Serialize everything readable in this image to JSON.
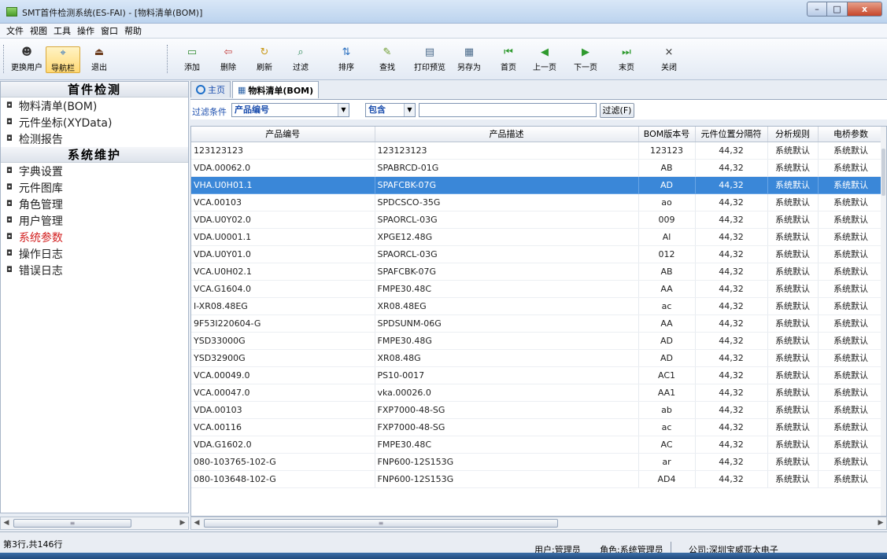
{
  "window": {
    "title": "SMT首件检测系统(ES-FAI) - [物料清单(BOM)]",
    "buttons": {
      "minimize": "–",
      "maximize": "□",
      "close": "x"
    }
  },
  "menu": [
    "文件",
    "视图",
    "工具",
    "操作",
    "窗口",
    "帮助"
  ],
  "toolbar": {
    "items": [
      {
        "label": "更换用户",
        "icon": "switch-user-icon",
        "glyph": "☻"
      },
      {
        "label": "导航栏",
        "icon": "navigation-icon",
        "glyph": "⌖"
      },
      {
        "label": "退出",
        "icon": "exit-icon",
        "glyph": "⏏"
      },
      {
        "label": "添加",
        "icon": "add-icon",
        "glyph": "▭"
      },
      {
        "label": "删除",
        "icon": "delete-icon",
        "glyph": "⇦"
      },
      {
        "label": "刷新",
        "icon": "refresh-icon",
        "glyph": "↻"
      },
      {
        "label": "过滤",
        "icon": "filter-icon",
        "glyph": "⌕"
      },
      {
        "label": "排序",
        "icon": "sort-icon",
        "glyph": "⇅"
      },
      {
        "label": "查找",
        "icon": "find-icon",
        "glyph": "✎"
      },
      {
        "label": "打印预览",
        "icon": "print-preview-icon",
        "glyph": "▤"
      },
      {
        "label": "另存为",
        "icon": "save-as-icon",
        "glyph": "▦"
      },
      {
        "label": "首页",
        "icon": "first-page-icon",
        "glyph": "⏮"
      },
      {
        "label": "上一页",
        "icon": "previous-page-icon",
        "glyph": "◀"
      },
      {
        "label": "下一页",
        "icon": "next-page-icon",
        "glyph": "▶"
      },
      {
        "label": "末页",
        "icon": "last-page-icon",
        "glyph": "⏭"
      },
      {
        "label": "关闭",
        "icon": "close-icon",
        "glyph": "×"
      }
    ]
  },
  "sidebar": {
    "section1": "首件检测",
    "items1": [
      "物料清单(BOM)",
      "元件坐标(XYData)",
      "检测报告"
    ],
    "section2": "系统维护",
    "items2": [
      "字典设置",
      "元件图库",
      "角色管理",
      "用户管理",
      "系统参数",
      "操作日志",
      "错误日志"
    ],
    "bullet": "◘"
  },
  "tabs": [
    {
      "label": "主页"
    },
    {
      "label": "物料清单(BOM)"
    }
  ],
  "filter": {
    "label": "过滤条件",
    "field": "产品编号",
    "operator": "包含",
    "button": "过滤(F)",
    "arrow": "▼"
  },
  "table": {
    "columns": [
      "产品编号",
      "产品描述",
      "BOM版本号",
      "元件位置分隔符",
      "分析规则",
      "电桥参数"
    ],
    "rows": [
      [
        "123123123",
        "123123123",
        "123123",
        "44,32",
        "系统默认",
        "系统默认"
      ],
      [
        "VDA.00062.0",
        "SPABRCD-01G",
        "AB",
        "44,32",
        "系统默认",
        "系统默认"
      ],
      [
        "VHA.U0H01.1",
        "SPAFCBK-07G",
        "AD",
        "44,32",
        "系统默认",
        "系统默认"
      ],
      [
        "VCA.00103",
        "SPDCSCO-35G",
        "ao",
        "44,32",
        "系统默认",
        "系统默认"
      ],
      [
        "VDA.U0Y02.0",
        "SPAORCL-03G",
        "009",
        "44,32",
        "系统默认",
        "系统默认"
      ],
      [
        "VDA.U0001.1",
        "XPGE12.48G",
        "Al",
        "44,32",
        "系统默认",
        "系统默认"
      ],
      [
        "VDA.U0Y01.0",
        "SPAORCL-03G",
        "012",
        "44,32",
        "系统默认",
        "系统默认"
      ],
      [
        "VCA.U0H02.1",
        "SPAFCBK-07G",
        "AB",
        "44,32",
        "系统默认",
        "系统默认"
      ],
      [
        "VCA.G1604.0",
        "FMPE30.48C",
        "AA",
        "44,32",
        "系统默认",
        "系统默认"
      ],
      [
        "I-XR08.48EG",
        "XR08.48EG",
        "ac",
        "44,32",
        "系统默认",
        "系统默认"
      ],
      [
        "9F53I220604-G",
        "SPDSUNM-06G",
        "AA",
        "44,32",
        "系统默认",
        "系统默认"
      ],
      [
        "YSD33000G",
        "FMPE30.48G",
        "AD",
        "44,32",
        "系统默认",
        "系统默认"
      ],
      [
        "YSD32900G",
        "XR08.48G",
        "AD",
        "44,32",
        "系统默认",
        "系统默认"
      ],
      [
        "VCA.00049.0",
        "PS10-0017",
        "AC1",
        "44,32",
        "系统默认",
        "系统默认"
      ],
      [
        "VCA.00047.0",
        "vka.00026.0",
        "AA1",
        "44,32",
        "系统默认",
        "系统默认"
      ],
      [
        "VDA.00103",
        "FXP7000-48-SG",
        "ab",
        "44,32",
        "系统默认",
        "系统默认"
      ],
      [
        "VCA.00116",
        "FXP7000-48-SG",
        "ac",
        "44,32",
        "系统默认",
        "系统默认"
      ],
      [
        "VDA.G1602.0",
        "FMPE30.48C",
        "AC",
        "44,32",
        "系统默认",
        "系统默认"
      ],
      [
        "080-103765-102-G",
        "FNP600-12S153G",
        "ar",
        "44,32",
        "系统默认",
        "系统默认"
      ],
      [
        "080-103648-102-G",
        "FNP600-12S153G",
        "AD4",
        "44,32",
        "系统默认",
        "系统默认"
      ]
    ],
    "selected_row": 2
  },
  "scrollbar": {
    "left_arrow": "◀",
    "right_arrow": "▶",
    "thumb_grip": "≡"
  },
  "status": {
    "rows": "第3行,共146行",
    "user": "用户:管理员",
    "role": "角色:系统管理员",
    "company": "公司:深圳宝威亚太电子"
  },
  "colors": {
    "selection": "#3a87d8",
    "accent": "#1d4fae",
    "highlight_nav": "#d21f1f"
  }
}
